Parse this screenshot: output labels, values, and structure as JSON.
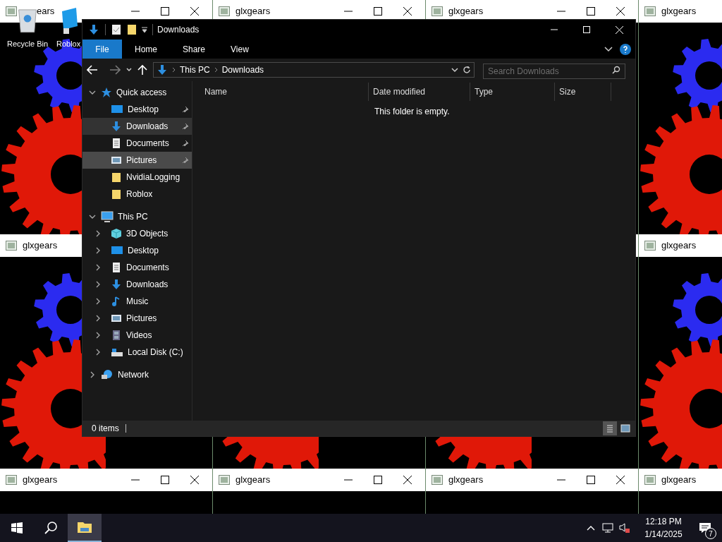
{
  "glx_windows": [
    {
      "title": "ears"
    },
    {
      "title": "glxgears"
    },
    {
      "title": "glxgears"
    },
    {
      "title": "glxgears"
    },
    {
      "title": "glxgears"
    },
    {
      "title": "glxgears"
    },
    {
      "title": "glxgears"
    },
    {
      "title": "glxgears"
    },
    {
      "title": "glxgears"
    },
    {
      "title": "glxgears"
    }
  ],
  "desktop_icons": [
    {
      "label": "Recycle Bin",
      "kind": "recycle"
    },
    {
      "label": "Roblox",
      "kind": "roblox"
    }
  ],
  "explorer": {
    "title": "Downloads",
    "ribbon_tabs": [
      {
        "label": "File",
        "selected": true
      },
      {
        "label": "Home",
        "selected": false
      },
      {
        "label": "Share",
        "selected": false
      },
      {
        "label": "View",
        "selected": false
      }
    ],
    "address": {
      "crumbs": [
        "This PC",
        "Downloads"
      ]
    },
    "search": {
      "placeholder": "Search Downloads"
    },
    "nav": [
      {
        "label": "Quick access",
        "kind": "star",
        "expanded": true,
        "selected": false,
        "children": [
          {
            "label": "Desktop",
            "kind": "desktop",
            "pinned": true,
            "selected": false
          },
          {
            "label": "Downloads",
            "kind": "download",
            "pinned": true,
            "selected": true
          },
          {
            "label": "Documents",
            "kind": "document",
            "pinned": true,
            "selected": false
          },
          {
            "label": "Pictures",
            "kind": "picture",
            "pinned": true,
            "selected": false,
            "hovered": true
          },
          {
            "label": "NvidiaLogging",
            "kind": "folder",
            "selected": false
          },
          {
            "label": "Roblox",
            "kind": "folder",
            "selected": false
          }
        ]
      },
      {
        "label": "This PC",
        "kind": "pc",
        "expanded": true,
        "selected": false,
        "children": [
          {
            "label": "3D Objects",
            "kind": "cube",
            "expanded": false,
            "selected": false
          },
          {
            "label": "Desktop",
            "kind": "desktop",
            "expanded": false,
            "selected": false
          },
          {
            "label": "Documents",
            "kind": "document",
            "expanded": false,
            "selected": false
          },
          {
            "label": "Downloads",
            "kind": "download",
            "expanded": false,
            "selected": false
          },
          {
            "label": "Music",
            "kind": "music",
            "expanded": false,
            "selected": false
          },
          {
            "label": "Pictures",
            "kind": "picture",
            "expanded": false,
            "selected": false
          },
          {
            "label": "Videos",
            "kind": "video",
            "expanded": false,
            "selected": false
          },
          {
            "label": "Local Disk (C:)",
            "kind": "disk",
            "expanded": false,
            "selected": false
          }
        ]
      },
      {
        "label": "Network",
        "kind": "network",
        "expanded": false,
        "selected": false
      }
    ],
    "columns": [
      "Name",
      "Date modified",
      "Type",
      "Size"
    ],
    "empty_message": "This folder is empty.",
    "status": "0 items",
    "views": [
      {
        "kind": "details",
        "selected": true
      },
      {
        "kind": "large",
        "selected": false
      }
    ]
  },
  "taskbar": {
    "time": "12:18 PM",
    "date": "1/14/2025",
    "notification_count": "7"
  }
}
